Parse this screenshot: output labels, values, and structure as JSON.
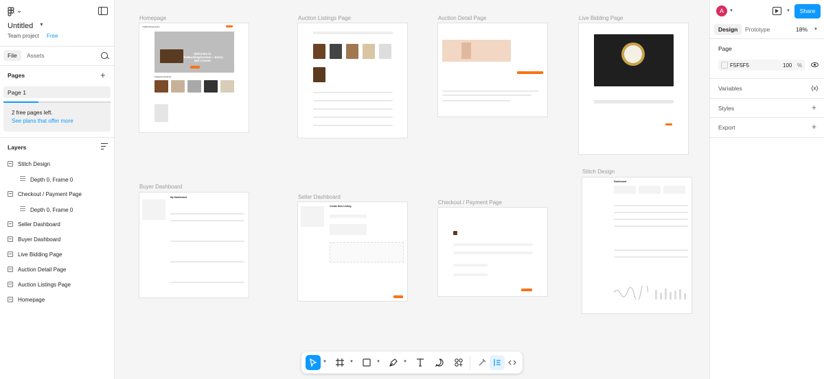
{
  "file": {
    "title": "Untitled",
    "team": "Team project",
    "plan": "Free"
  },
  "left_tabs": {
    "file": "File",
    "assets": "Assets"
  },
  "pages": {
    "label": "Pages",
    "items": [
      {
        "name": "Page 1"
      }
    ],
    "usage_fraction": 0.33
  },
  "free_notice": {
    "line1": "2 free pages left.",
    "link": "See plans that offer more"
  },
  "layers": {
    "label": "Layers",
    "items": [
      {
        "name": "Stitch Design",
        "indent": false
      },
      {
        "name": "Depth 0, Frame 0",
        "indent": true
      },
      {
        "name": "Checkout / Payment Page",
        "indent": false
      },
      {
        "name": "Depth 0, Frame 0",
        "indent": true
      },
      {
        "name": "Seller Dashboard",
        "indent": false
      },
      {
        "name": "Buyer Dashboard",
        "indent": false
      },
      {
        "name": "Live Bidding Page",
        "indent": false
      },
      {
        "name": "Auction Detail Page",
        "indent": false
      },
      {
        "name": "Auction Listings Page",
        "indent": false
      },
      {
        "name": "Homepage",
        "indent": false
      }
    ]
  },
  "frames": {
    "homepage": {
      "label": "Homepage",
      "brand": "TheBuckingAuction",
      "hero": "Welcome to TheBuckingAuction – Every Bid Counts",
      "section": "Featured Auctions"
    },
    "listings": {
      "label": "Auction Listings Page"
    },
    "detail": {
      "label": "Auction Detail Page"
    },
    "live": {
      "label": "Live Bidding Page"
    },
    "buyer": {
      "label": "Buyer Dashboard",
      "heading": "My Dashboard"
    },
    "seller": {
      "label": "Seller Dashboard",
      "heading": "Create New Listing"
    },
    "checkout": {
      "label": "Checkout / Payment Page"
    },
    "stitch": {
      "label": "Stitch Design",
      "heading": "Dashboard"
    }
  },
  "right": {
    "avatar_initial": "A",
    "share": "Share",
    "tab_design": "Design",
    "tab_prototype": "Prototype",
    "zoom": "18%",
    "page_section": "Page",
    "bg_hex": "F5F5F5",
    "bg_opacity": "100",
    "bg_opacity_unit": "%",
    "variables": "Variables",
    "styles": "Styles",
    "export": "Export"
  },
  "help": "?",
  "colors": {
    "accent": "#0d99ff",
    "brand_orange": "#f97316"
  }
}
